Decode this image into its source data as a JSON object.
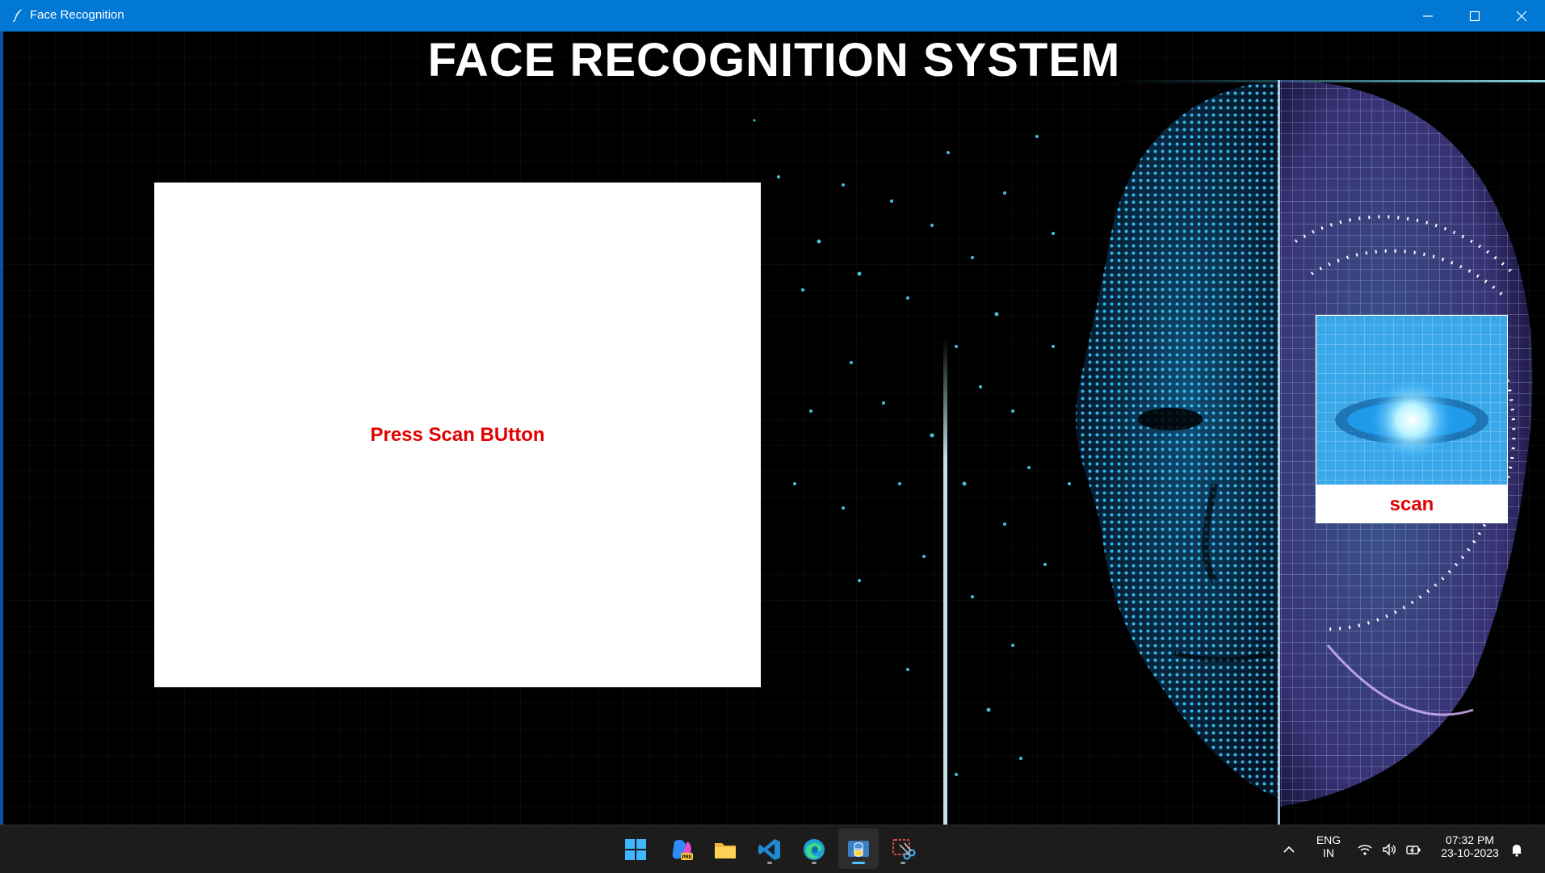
{
  "window": {
    "title": "Face Recognition",
    "icon": "feather-icon",
    "controls": [
      "minimize-icon",
      "maximize-icon",
      "close-icon"
    ]
  },
  "app": {
    "heading": "FACE RECOGNITION SYSTEM",
    "camera_panel": {
      "message": "Press Scan BUtton"
    },
    "scan_button": {
      "label": "scan"
    },
    "background_colors": {
      "face_blue": "#2aa6ff",
      "face_purple": "#a78bff",
      "particle_cyan": "#4fe3ff"
    }
  },
  "taskbar": {
    "apps": [
      {
        "name": "start",
        "icon": "windows-start-icon"
      },
      {
        "name": "copilot",
        "icon": "copilot-pre-icon"
      },
      {
        "name": "file-explorer",
        "icon": "folder-icon"
      },
      {
        "name": "vscode",
        "icon": "vscode-icon"
      },
      {
        "name": "edge",
        "icon": "edge-icon"
      },
      {
        "name": "python",
        "icon": "python-icon"
      },
      {
        "name": "snipping-tool",
        "icon": "snipping-tool-icon"
      }
    ],
    "tray": {
      "language_top": "ENG",
      "language_bottom": "IN",
      "time": "07:32 PM",
      "date": "23-10-2023"
    }
  }
}
